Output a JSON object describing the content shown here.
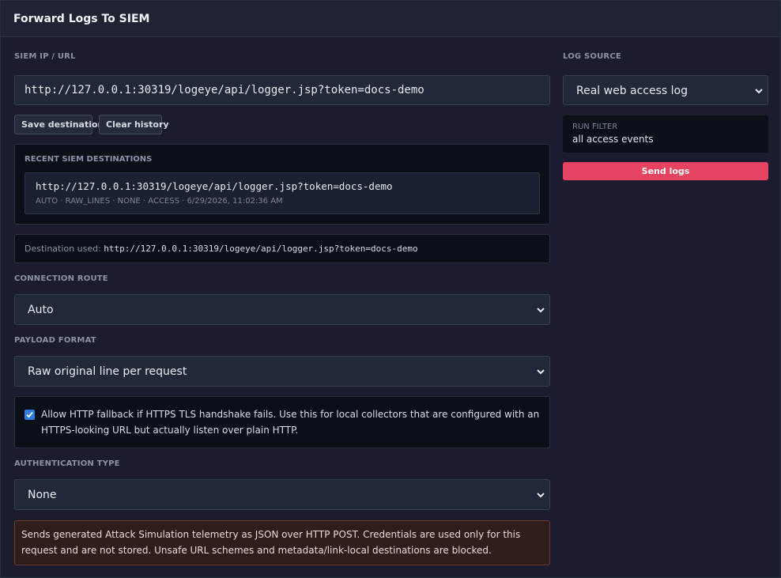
{
  "header": {
    "title": "Forward Logs To SIEM"
  },
  "siem": {
    "label": "SIEM IP / URL",
    "value": "http://127.0.0.1:30319/logeye/api/logger.jsp?token=docs-demo",
    "save_label": "Save destination",
    "clear_label": "Clear history"
  },
  "recent": {
    "title": "RECENT SIEM DESTINATIONS",
    "items": [
      {
        "url": "http://127.0.0.1:30319/logeye/api/logger.jsp?token=docs-demo",
        "meta": "AUTO · RAW_LINES · NONE · ACCESS · 6/29/2026, 11:02:36 AM"
      }
    ]
  },
  "destination_used": {
    "label": "Destination used:",
    "value": "http://127.0.0.1:30319/logeye/api/logger.jsp?token=docs-demo"
  },
  "connection_route": {
    "label": "CONNECTION ROUTE",
    "selected": "Auto"
  },
  "payload_format": {
    "label": "PAYLOAD FORMAT",
    "selected": "Raw original line per request"
  },
  "http_fallback": {
    "checked": true,
    "text": "Allow HTTP fallback if HTTPS TLS handshake fails. Use this for local collectors that are configured with an HTTPS-looking URL but actually listen over plain HTTP."
  },
  "auth": {
    "label": "AUTHENTICATION TYPE",
    "selected": "None"
  },
  "notice": {
    "text": "Sends generated Attack Simulation telemetry as JSON over HTTP POST. Credentials are used only for this request and are not stored. Unsafe URL schemes and metadata/link-local destinations are blocked."
  },
  "log_source": {
    "label": "LOG SOURCE",
    "selected": "Real web access log"
  },
  "run_filter": {
    "label": "RUN FILTER",
    "value": "all access events"
  },
  "send_button": {
    "label": "Send logs"
  },
  "colors": {
    "accent_button": "#e5435f",
    "checkbox": "#2f7de1",
    "notice_border": "#6b3a2c",
    "background": "#1b1d2e"
  }
}
